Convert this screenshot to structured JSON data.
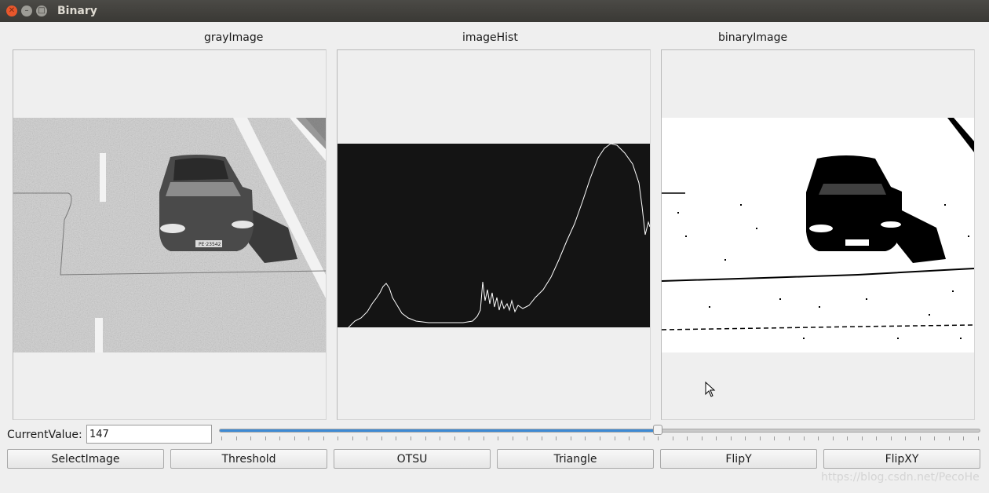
{
  "window": {
    "title": "Binary"
  },
  "panels": [
    {
      "label": "grayImage"
    },
    {
      "label": "imageHist"
    },
    {
      "label": "binaryImage"
    }
  ],
  "controls": {
    "current_value_label": "CurrentValue:",
    "current_value": "147",
    "slider": {
      "min": 0,
      "max": 255,
      "value": 147
    }
  },
  "buttons": [
    "SelectImage",
    "Threshold",
    "OTSU",
    "Triangle",
    "FlipY",
    "FlipXY"
  ],
  "watermark": "https://blog.csdn.net/PecoHe",
  "icons": [
    "close-icon",
    "minimize-icon",
    "maximize-icon",
    "mouse-cursor-icon"
  ],
  "colors": {
    "accent": "#3d8ad4",
    "titlebar": "#3d3c38",
    "close": "#e8572c"
  }
}
